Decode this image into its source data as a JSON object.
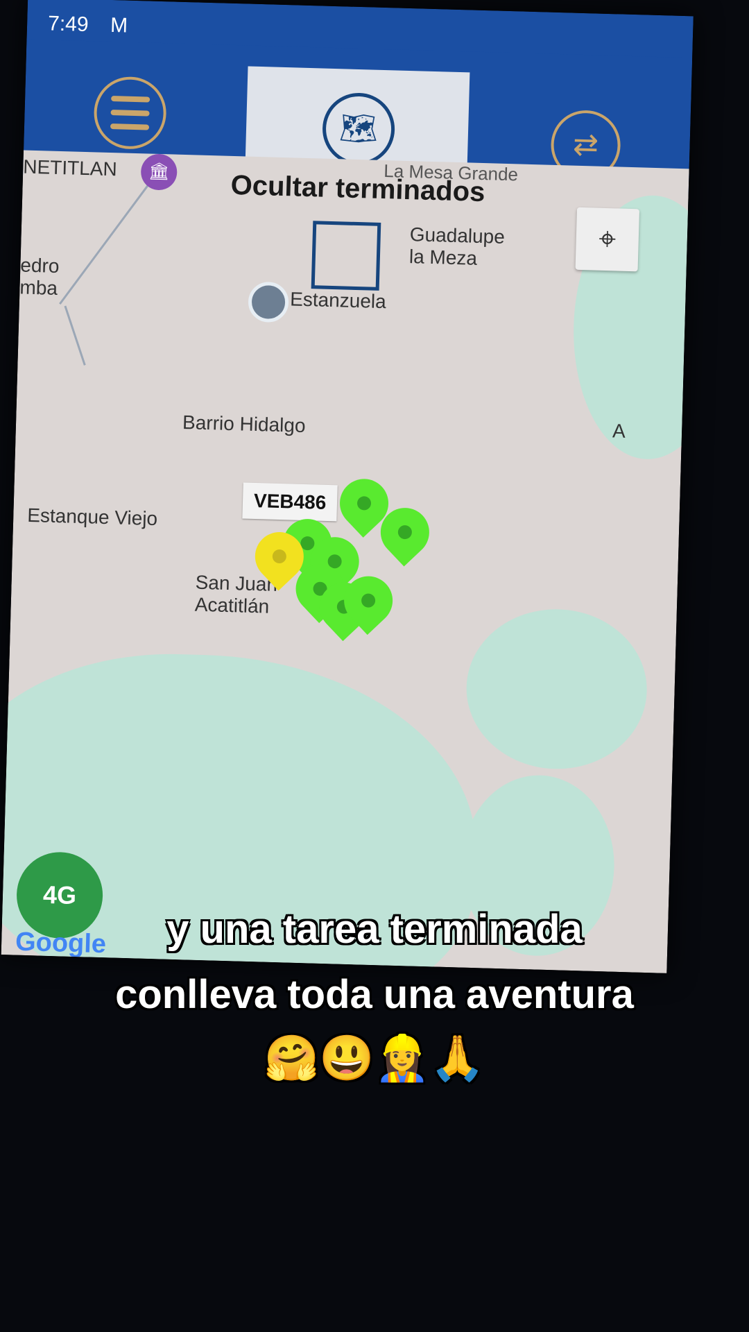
{
  "status_bar": {
    "time": "7:49",
    "mail_icon": "M",
    "icons": [
      "location",
      "airplane",
      "battery"
    ]
  },
  "map": {
    "hide_label": "Ocultar terminados",
    "places": [
      "NETITLAN",
      "La Mesa Grande",
      "Guadalupe la Meza",
      "edro mba",
      "Estanzuela",
      "Barrio Hidalgo",
      "A",
      "Estanque Viejo",
      "San Juan Acatitlán"
    ],
    "vehicle_tag": "VEB486",
    "fab_label": "4G",
    "google": "Google"
  },
  "caption": {
    "line1": "y una tarea terminada",
    "line2": "conlleva toda una aventura",
    "emoji": "🤗😃👷‍♀️🙏"
  }
}
